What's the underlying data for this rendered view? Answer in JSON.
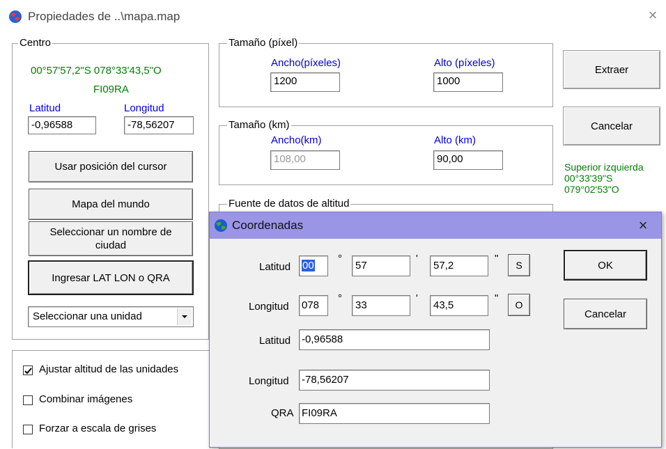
{
  "window": {
    "title": "Propiedades de ..\\mapa.map",
    "close_symbol": "×"
  },
  "centro": {
    "legend": "Centro",
    "coords": "00°57'57,2\"S 078°33'43,5\"O",
    "qra": "FI09RA",
    "lat_label": "Latitud",
    "lon_label": "Longitud",
    "lat_value": "-0,96588",
    "lon_value": "-78,56207",
    "btn_cursor": "Usar posición del cursor",
    "btn_world": "Mapa del mundo",
    "btn_city": "Seleccionar un nombre de ciudad",
    "btn_latlon": "Ingresar LAT LON o QRA",
    "unit_select": "Seleccionar una unidad"
  },
  "size_px": {
    "legend": "Tamaño (píxel)",
    "width_label": "Ancho(píxeles)",
    "height_label": "Alto (píxeles)",
    "width_value": "1200",
    "height_value": "1000"
  },
  "size_km": {
    "legend": "Tamaño (km)",
    "width_label": "Ancho(km)",
    "height_label": "Alto (km)",
    "width_value": "108,00",
    "height_value": "90,00"
  },
  "altitude_source": {
    "legend": "Fuente de datos de altitud"
  },
  "right_panel": {
    "btn_extract": "Extraer",
    "btn_cancel": "Cancelar",
    "info_title": "Superior izquierda",
    "info_lat": "00°33'39\"S",
    "info_lon": "079°02'53\"O"
  },
  "options": {
    "adjust_altitude": "Ajustar altitud de las unidades",
    "adjust_altitude_checked": true,
    "combine_images": "Combinar imágenes",
    "combine_images_checked": false,
    "force_grayscale": "Forzar a escala de grises",
    "force_grayscale_checked": false
  },
  "coord_dialog": {
    "title": "Coordenadas",
    "close_symbol": "×",
    "lat_label": "Latitud",
    "lat_deg": "00",
    "lat_min": "57",
    "lat_sec": "57,2",
    "lat_hemi": "S",
    "lon_label": "Longitud",
    "lon_deg": "078",
    "lon_min": "33",
    "lon_sec": "43,5",
    "lon_hemi": "O",
    "deg_symbol": "°",
    "min_symbol": "'",
    "sec_symbol": "\"",
    "lat_dec_label": "Latitud",
    "lat_dec_value": "-0,96588",
    "lon_dec_label": "Longitud",
    "lon_dec_value": "-78,56207",
    "qra_label": "QRA",
    "qra_value": "FI09RA",
    "btn_ok": "OK",
    "btn_cancel": "Cancelar"
  },
  "colors": {
    "green_text": "#008000",
    "blue_label": "#0000d8",
    "dialog_title_bar": "#9b95e6",
    "selection": "#2a60e8"
  }
}
